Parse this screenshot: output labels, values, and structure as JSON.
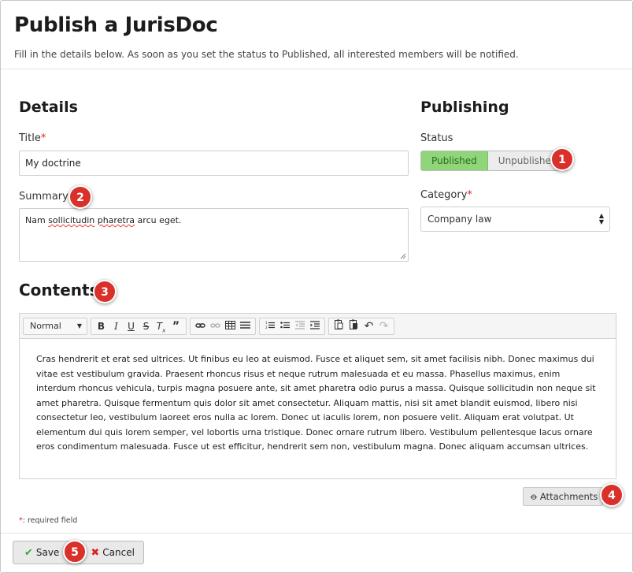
{
  "header": {
    "title": "Publish a JurisDoc",
    "subtitle": "Fill in the details below. As soon as you set the status to Published, all interested members will be notified."
  },
  "details": {
    "heading": "Details",
    "title_label": "Title",
    "title_value": "My doctrine",
    "summary_label": "Summary",
    "summary_value_part1": "Nam ",
    "summary_value_misspelled1": "sollicitudin",
    "summary_value_space": " ",
    "summary_value_misspelled2": "pharetra",
    "summary_value_part2": " arcu eget."
  },
  "publishing": {
    "heading": "Publishing",
    "status_label": "Status",
    "status_options": [
      "Published",
      "Unpublished"
    ],
    "status_selected": "Published",
    "category_label": "Category",
    "category_value": "Company law"
  },
  "contents": {
    "heading": "Contents",
    "format_value": "Normal",
    "body": "Cras hendrerit et erat sed ultrices. Ut finibus eu leo at euismod. Fusce et aliquet sem, sit amet facilisis nibh. Donec maximus dui vitae est vestibulum gravida. Praesent rhoncus risus et neque rutrum malesuada et eu massa. Phasellus maximus, enim interdum rhoncus vehicula, turpis magna posuere ante, sit amet pharetra odio purus a massa. Quisque sollicitudin non neque sit amet pharetra. Quisque fermentum quis dolor sit amet consectetur. Aliquam mattis, nisi sit amet blandit euismod, libero nisi consectetur leo, vestibulum laoreet eros nulla ac lorem. Donec ut iaculis lorem, non posuere velit. Aliquam erat volutpat. Ut elementum dui quis lorem semper, vel lobortis urna tristique. Donec ornare rutrum libero. Vestibulum pellentesque lacus ornare eros condimentum malesuada. Fusce ut est efficitur, hendrerit sem non, vestibulum magna. Donec aliquam accumsan ultrices."
  },
  "attachments_label": "Attachments",
  "required_marker": "*",
  "required_note": ": required field",
  "actions": {
    "save": "Save",
    "cancel": "Cancel"
  },
  "badges": [
    "1",
    "2",
    "3",
    "4",
    "5"
  ],
  "colors": {
    "published_bg": "#8fd57a",
    "badge_red": "#d9302a",
    "required": "#dd2222"
  }
}
